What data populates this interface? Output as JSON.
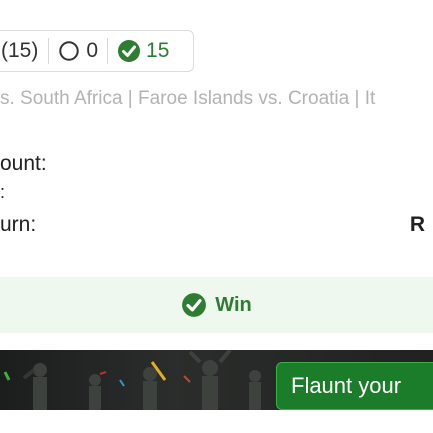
{
  "stats": {
    "total": "(15)",
    "losses": "0",
    "wins": "15"
  },
  "matches_ticker": "s. South Africa | Faroe Islands vs. Croatia | It",
  "details": {
    "amount_label": "ount:",
    "colon_label": ":",
    "return_label": "urn:",
    "return_value": "R"
  },
  "result": {
    "label": "Win"
  },
  "banner": {
    "share_button_label": "Flaunt your"
  },
  "colors": {
    "win_green": "#2e7d32",
    "result_bg": "#eef8ee",
    "button_green": "#1b7c2a"
  }
}
